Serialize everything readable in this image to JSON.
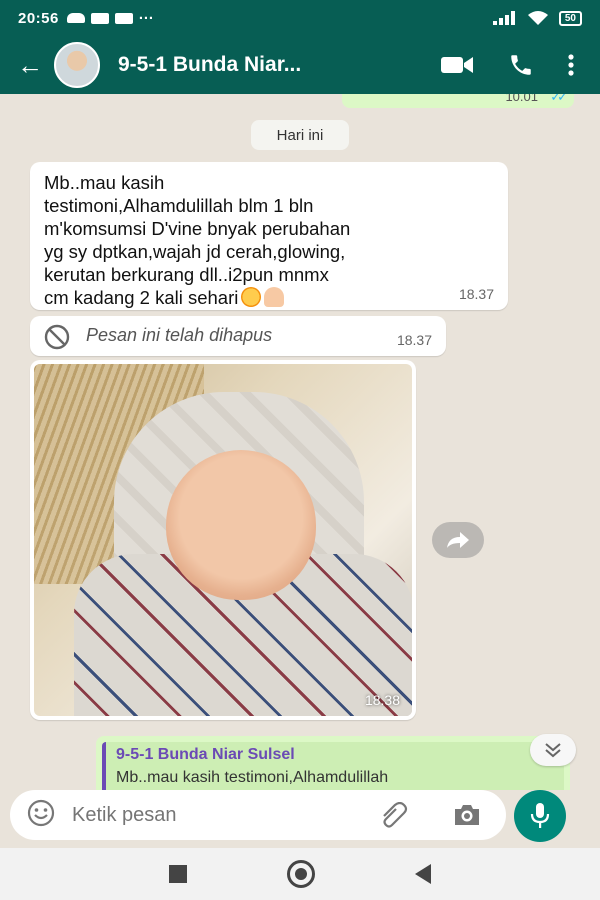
{
  "status_bar": {
    "time": "20:56",
    "battery": "50"
  },
  "header": {
    "back_glyph": "←",
    "contact_name": "9-5-1 Bunda Niar...",
    "icons": [
      "video-call-icon",
      "phone-icon",
      "more-vert-icon"
    ]
  },
  "chat": {
    "previous_message_time": "10.01",
    "day_separator": "Hari ini",
    "messages": [
      {
        "type": "text",
        "text": "Mb..mau kasih\ntestimoni,Alhamdulillah blm 1 bln\nm'komsumsi D'vine bnyak perubahan\nyg sy dptkan,wajah jd cerah,glowing,\nkerutan berkurang dll..i2pun mnmx\ncm kadang 2 kali sehari",
        "emojis": [
          "smiling-face-with-hearts",
          "folded-hands"
        ],
        "time": "18.37"
      },
      {
        "type": "deleted",
        "text": "Pesan ini telah dihapus",
        "time": "18.37"
      },
      {
        "type": "image",
        "time": "18.38"
      }
    ],
    "reply_preview": {
      "name": "9-5-1 Bunda Niar Sulsel",
      "text": "Mb..mau kasih testimoni,Alhamdulillah"
    }
  },
  "input": {
    "placeholder": "Ketik pesan"
  },
  "colors": {
    "header": "#075e54",
    "accent": "#00897b",
    "outgoing": "#dcf8c6",
    "background": "#e9e3da"
  }
}
